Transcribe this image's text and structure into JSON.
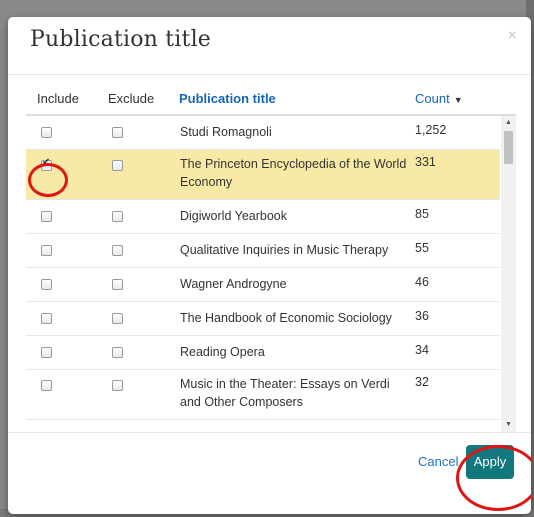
{
  "modal": {
    "title": "Publication title",
    "close_icon": "×"
  },
  "table": {
    "headers": {
      "include": "Include",
      "exclude": "Exclude",
      "title": "Publication title",
      "count": "Count"
    },
    "sort_icon": "▼",
    "rows": [
      {
        "title": "Studi Romagnoli",
        "count": "1,252",
        "include": false,
        "exclude": false,
        "selected": false
      },
      {
        "title": "The Princeton Encyclopedia of the World Economy",
        "count": "331",
        "include": true,
        "exclude": false,
        "selected": true
      },
      {
        "title": "Digiworld Yearbook",
        "count": "85",
        "include": false,
        "exclude": false,
        "selected": false
      },
      {
        "title": "Qualitative Inquiries in Music Therapy",
        "count": "55",
        "include": false,
        "exclude": false,
        "selected": false
      },
      {
        "title": "Wagner Androgyne",
        "count": "46",
        "include": false,
        "exclude": false,
        "selected": false
      },
      {
        "title": "The Handbook of Economic Sociology",
        "count": "36",
        "include": false,
        "exclude": false,
        "selected": false
      },
      {
        "title": "Reading Opera",
        "count": "34",
        "include": false,
        "exclude": false,
        "selected": false
      },
      {
        "title": "Music in the Theater: Essays on Verdi and Other Composers",
        "count": "32",
        "include": false,
        "exclude": false,
        "selected": false
      }
    ]
  },
  "footer": {
    "cancel_label": "Cancel",
    "apply_label": "Apply"
  },
  "colors": {
    "accent": "#12787d",
    "link": "#1565b8",
    "selected_row": "#f8eaa6",
    "annotation": "#e01414"
  },
  "icons": {
    "close": "close-icon",
    "sort": "sort-desc-icon",
    "scroll_up": "chevron-up-icon",
    "scroll_down": "chevron-down-icon",
    "check": "checkmark-icon"
  }
}
